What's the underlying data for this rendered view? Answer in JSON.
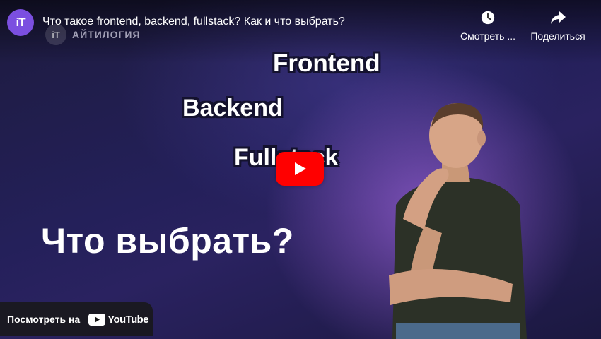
{
  "header": {
    "channel_avatar_text": "iT",
    "video_title": "Что такое frontend, backend, fullstack? Как и что выбрать?",
    "watch_later_label": "Смотреть ...",
    "share_label": "Поделиться",
    "watch_later_icon": "clock-icon",
    "share_icon": "share-arrow-icon"
  },
  "thumbnail": {
    "brand_mark": "iT",
    "brand_name": "АЙТИЛОГИЯ",
    "words": [
      "Frontend",
      "Backend",
      "Fullstack"
    ],
    "headline": "Что выбрать?"
  },
  "footer": {
    "watch_on_label": "Посмотреть на",
    "youtube_logo_text": "YouTube"
  },
  "colors": {
    "play_button": "#ff0000",
    "avatar": "#7b4fe0"
  }
}
